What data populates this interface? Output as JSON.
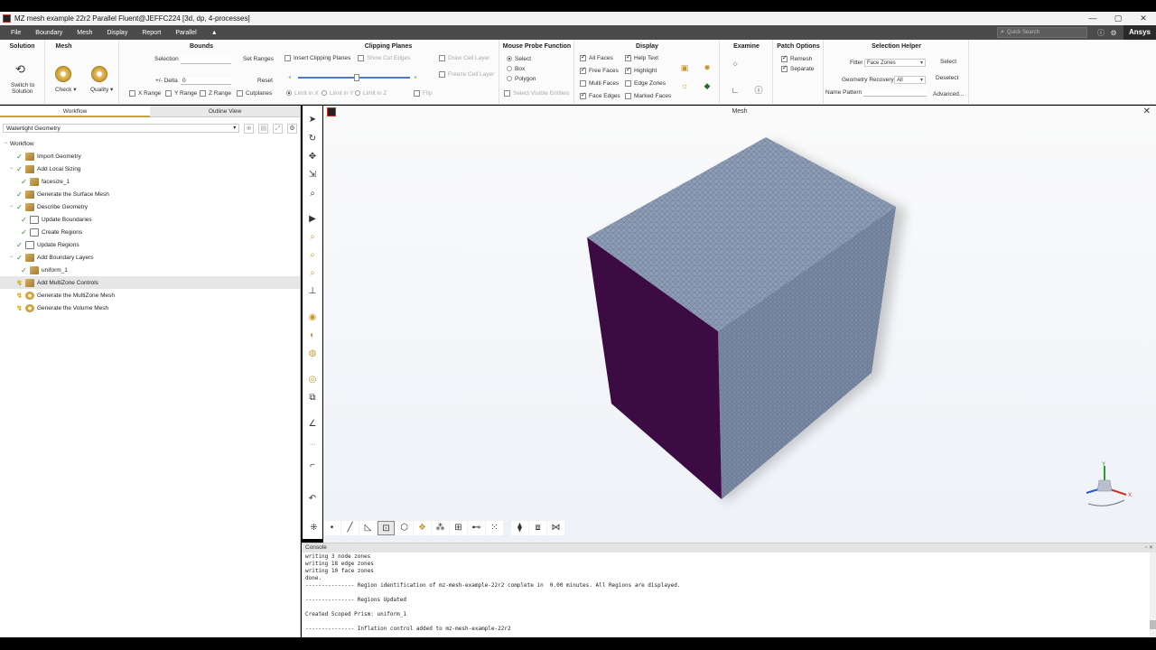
{
  "window": {
    "title": "MZ mesh example 22r2 Parallel Fluent@JEFFC224  [3d, dp, 4-processes]",
    "controls": [
      "—",
      "▢",
      "✕"
    ]
  },
  "menu": {
    "items": [
      "File",
      "Boundary",
      "Mesh",
      "Display",
      "Report",
      "Parallel",
      "▲"
    ],
    "search_placeholder": "Quick Search",
    "brand": "Ansys"
  },
  "ribbon": {
    "solution": {
      "header": "Solution",
      "switch_label_1": "Switch to",
      "switch_label_2": "Solution"
    },
    "mesh": {
      "header": "Mesh",
      "check": "Check",
      "quality": "Quality"
    },
    "bounds": {
      "header": "Bounds",
      "selection": "Selection",
      "set_ranges": "Set Ranges",
      "delta": "+/- Delta",
      "delta_value": "0",
      "reset": "Reset",
      "x_range": "X Range",
      "y_range": "Y Range",
      "z_range": "Z Range",
      "cutplanes": "Cutplanes"
    },
    "clipping": {
      "header": "Clipping Planes",
      "insert": "Insert Clipping Planes",
      "show_cut_edges": "Show Cut Edges",
      "draw_cell_layer": "Draw Cell Layer",
      "freeze_cell_layer": "Freeze Cell Layer",
      "limit_x": "Limit in X",
      "limit_y": "Limit in Y",
      "limit_z": "Limit in Z",
      "flip": "Flip"
    },
    "probe": {
      "header": "Mouse Probe Function",
      "select": "Select",
      "box": "Box",
      "polygon": "Polygon",
      "select_visible": "Select Visible Entities"
    },
    "display": {
      "header": "Display",
      "all_faces": "All Faces",
      "free_faces": "Free Faces",
      "multi_faces": "Multi Faces",
      "face_edges": "Face Edges",
      "help_text": "Help Text",
      "highlight": "Highlight",
      "edge_zones": "Edge Zones",
      "marked_faces": "Marked Faces"
    },
    "examine": {
      "header": "Examine"
    },
    "patch": {
      "header": "Patch Options",
      "remesh": "Remesh",
      "separate": "Separate"
    },
    "selection_helper": {
      "header": "Selection Helper",
      "filter_label": "Filter",
      "filter_value": "Face Zones",
      "select": "Select",
      "geometry_recovery_label": "Geometry Recovery",
      "geometry_recovery_value": "All",
      "deselect": "Deselect",
      "name_pattern": "Name Pattern",
      "advanced": "Advanced..."
    }
  },
  "left_panel": {
    "tabs": [
      "Workflow",
      "Outline View"
    ],
    "workflow_type": "Watertight Geometry",
    "tree": [
      {
        "label": "Workflow",
        "level": 0,
        "status": "",
        "icon": "none"
      },
      {
        "label": "Import Geometry",
        "level": 1,
        "status": "done",
        "icon": "task"
      },
      {
        "label": "Add Local Sizing",
        "level": 1,
        "status": "done",
        "icon": "task",
        "toggle": "−"
      },
      {
        "label": "facesize_1",
        "level": 2,
        "status": "done",
        "icon": "task"
      },
      {
        "label": "Generate the Surface Mesh",
        "level": 1,
        "status": "done",
        "icon": "task"
      },
      {
        "label": "Describe Geometry",
        "level": 1,
        "status": "done",
        "icon": "task",
        "toggle": "−"
      },
      {
        "label": "Update Boundaries",
        "level": 2,
        "status": "done",
        "icon": "frame"
      },
      {
        "label": "Create Regions",
        "level": 2,
        "status": "done",
        "icon": "frame"
      },
      {
        "label": "Update Regions",
        "level": 1,
        "status": "done",
        "icon": "frame"
      },
      {
        "label": "Add Boundary Layers",
        "level": 1,
        "status": "done",
        "icon": "task",
        "toggle": "−"
      },
      {
        "label": "uniform_1",
        "level": 2,
        "status": "done",
        "icon": "task"
      },
      {
        "label": "Add MultiZone Controls",
        "level": 1,
        "status": "pending",
        "icon": "task",
        "selected": true
      },
      {
        "label": "Generate the MultiZone Mesh",
        "level": 1,
        "status": "pending",
        "icon": "round"
      },
      {
        "label": "Generate the Volume Mesh",
        "level": 1,
        "status": "pending",
        "icon": "round"
      }
    ]
  },
  "viewport": {
    "title": "Mesh"
  },
  "console": {
    "title": "Console",
    "lines": [
      "writing 3 node zones",
      "writing 18 edge zones",
      "writing 10 face zones",
      "done.",
      "--------------- Region identification of mz-mesh-example-22r2 complete in  0.00 minutes. All Regions are displayed.",
      "",
      "--------------- Regions Updated",
      "",
      "Created Scoped Prism: uniform_1",
      "",
      "--------------- Inflation control added to mz-mesh-example-22r2"
    ]
  },
  "colors": {
    "menubar": "#4b4b4b",
    "mesh_face": "#8091ab",
    "mesh_side": "#3a0a40",
    "accent": "#c9a24b"
  }
}
